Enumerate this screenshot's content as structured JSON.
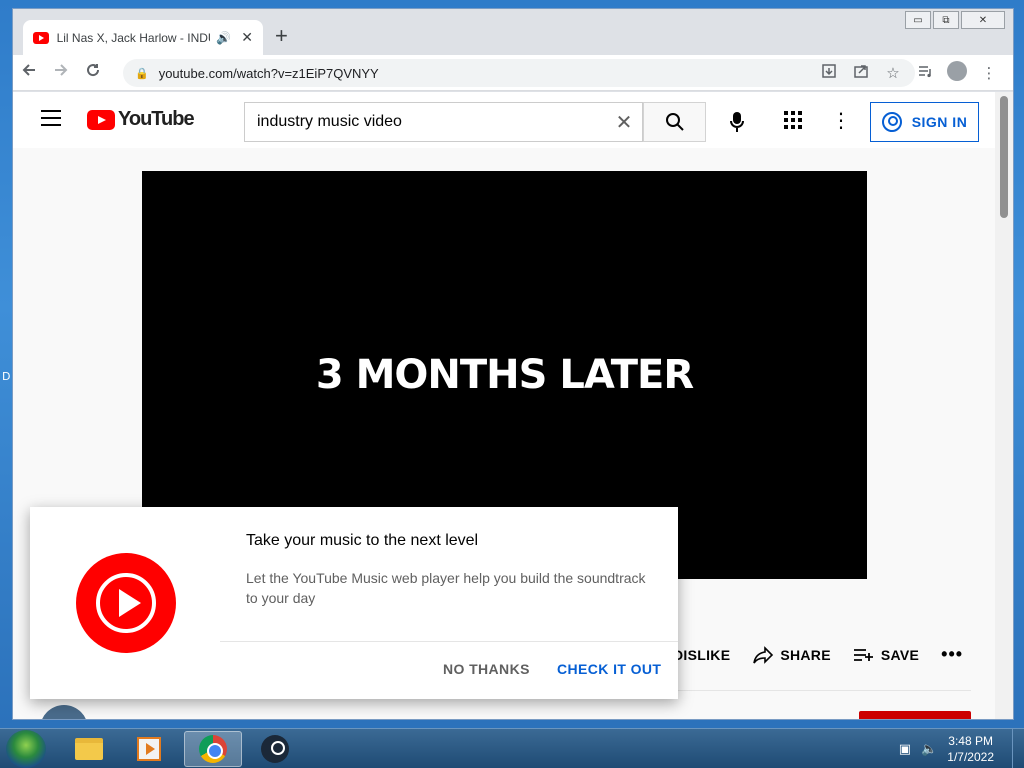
{
  "desktop": {
    "edge_letter": "D"
  },
  "browser": {
    "tab": {
      "title": "Lil Nas X, Jack Harlow - INDUSTRY BABY",
      "close": "✕",
      "speaker": "🔊"
    },
    "new_tab": "+",
    "window_controls": {
      "minimize": "▭",
      "restore": "⧉",
      "close": "✕"
    },
    "url": "youtube.com/watch?v=z1EiP7QVNYY"
  },
  "youtube": {
    "logo_text": "YouTube",
    "search_value": "industry music video",
    "sign_in": "SIGN IN",
    "video_caption": "3 MONTHS LATER",
    "actions": {
      "dislike": "DISLIKE",
      "share": "SHARE",
      "save": "SAVE",
      "more": "•••"
    }
  },
  "popup": {
    "title": "Take your music to the next level",
    "description": "Let the YouTube Music web player help you build the soundtrack to your day",
    "no_thanks": "NO THANKS",
    "check_it_out": "CHECK IT OUT"
  },
  "taskbar": {
    "time": "3:48 PM",
    "date": "1/7/2022"
  },
  "colors": {
    "youtube_red": "#ff0000",
    "link_blue": "#065fd4"
  }
}
